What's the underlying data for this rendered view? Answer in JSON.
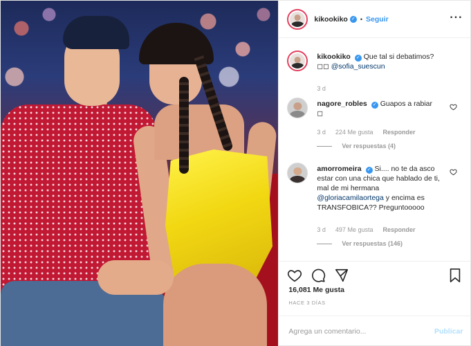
{
  "post": {
    "username": "kikookiko",
    "follow_label": "Seguir",
    "dot": "•",
    "more_icon": "more-horizontal-icon",
    "likes": "16,081 Me gusta",
    "date": "HACE 3 DÍAS"
  },
  "caption": {
    "username": "kikookiko",
    "text_1": "Que tal si debatimos?",
    "text_2": "◻◻",
    "mention": "@sofia_suescun",
    "time": "3 d"
  },
  "comments": [
    {
      "username": "nagore_robles",
      "text": "Guapos a rabiar",
      "text_2": "◻",
      "time": "3 d",
      "likes": "224 Me gusta",
      "reply_label": "Responder",
      "view_replies": "Ver respuestas (4)"
    },
    {
      "username": "amorromeira",
      "text": "Si.... no te da asco estar con una chica que hablado de ti, mal de mi hermana",
      "mention": "@gloriacamilaortega",
      "text_2": "y encima es TRANSFOBICA?? Preguntooooo",
      "time": "3 d",
      "likes": "497 Me gusta",
      "reply_label": "Responder",
      "view_replies": "Ver respuestas (146)"
    }
  ],
  "comment_box": {
    "placeholder": "Agrega un comentario...",
    "publish_label": "Publicar"
  },
  "colors": {
    "accent": "#3897f0",
    "text": "#262626",
    "muted": "#999999",
    "publish_disabled": "#b2dffc"
  },
  "icons": [
    "heart-icon",
    "comment-icon",
    "share-icon",
    "bookmark-icon",
    "verified-icon"
  ]
}
